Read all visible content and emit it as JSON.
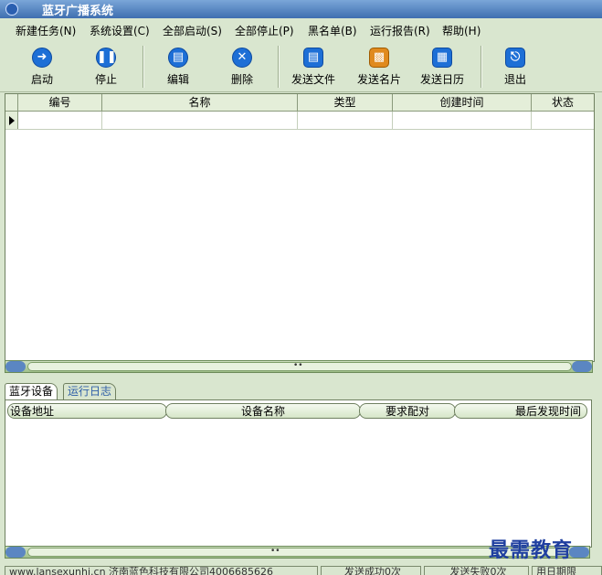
{
  "window": {
    "title": "蓝牙广播系统"
  },
  "menu": [
    "新建任务(N)",
    "系统设置(C)",
    "全部启动(S)",
    "全部停止(P)",
    "黑名单(B)",
    "运行报告(R)",
    "帮助(H)"
  ],
  "toolbar": {
    "start": "启动",
    "stop": "停止",
    "edit": "编辑",
    "delete": "删除",
    "send_file": "发送文件",
    "send_card": "发送名片",
    "send_calendar": "发送日历",
    "exit": "退出"
  },
  "task_table": {
    "columns": [
      "编号",
      "名称",
      "类型",
      "创建时间",
      "状态"
    ]
  },
  "tabs": [
    "蓝牙设备",
    "运行日志"
  ],
  "device_table": {
    "columns": [
      "设备地址",
      "设备名称",
      "要求配对",
      "最后发现时间"
    ]
  },
  "status": {
    "company": "www.lansexunhi.cn 济南蓝色科技有限公司4006685626",
    "success": "发送成功0次",
    "fail": "发送失败0次",
    "expire": "用日期限"
  },
  "watermark": "最需教育"
}
